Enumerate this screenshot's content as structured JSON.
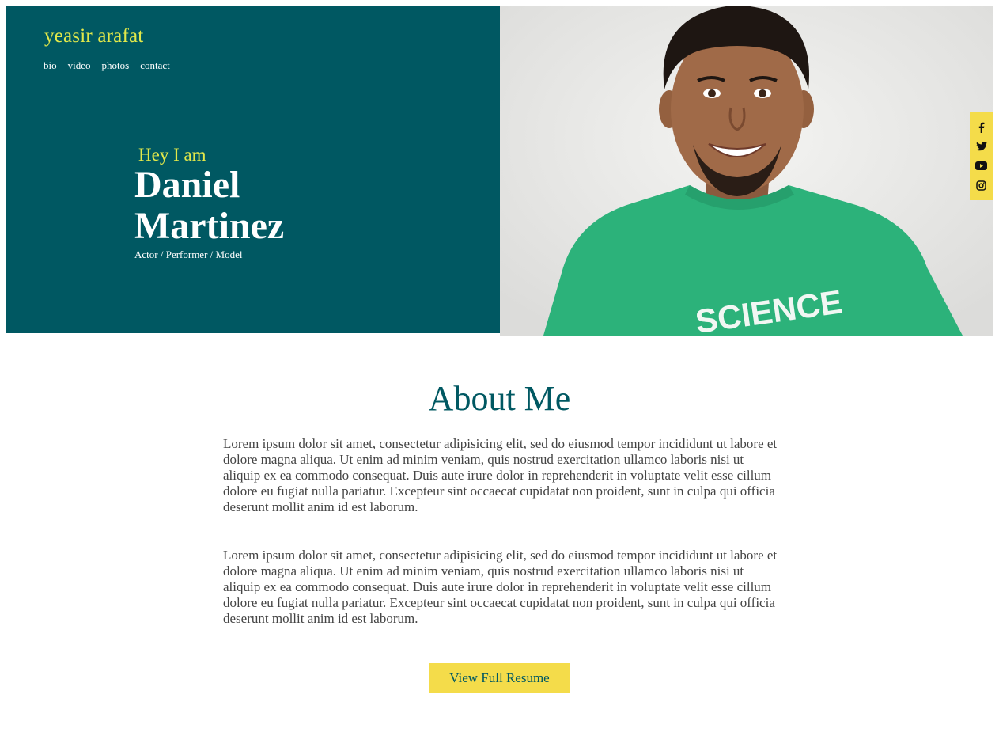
{
  "brand": {
    "name": "yeasir arafat"
  },
  "nav": [
    "bio",
    "video",
    "photos",
    "contact"
  ],
  "hero": {
    "greeting": "Hey I am",
    "first_name": "Daniel",
    "last_name": "Martinez",
    "tagline": "Actor / Performer / Model",
    "shirt_text": "SCIENCE"
  },
  "social": [
    "facebook-icon",
    "twitter-icon",
    "youtube-icon",
    "instagram-icon"
  ],
  "about": {
    "title": "About Me",
    "paragraphs": [
      "Lorem ipsum dolor sit amet, consectetur adipisicing elit, sed do eiusmod tempor incididunt ut labore et dolore magna aliqua. Ut enim ad minim veniam, quis nostrud exercitation ullamco laboris nisi ut aliquip ex ea commodo consequat. Duis aute irure dolor in reprehenderit in voluptate velit esse cillum dolore eu fugiat nulla pariatur. Excepteur sint occaecat cupidatat non proident, sunt in culpa qui officia deserunt mollit anim id est laborum.",
      "Lorem ipsum dolor sit amet, consectetur adipisicing elit, sed do eiusmod tempor incididunt ut labore et dolore magna aliqua. Ut enim ad minim veniam, quis nostrud exercitation ullamco laboris nisi ut aliquip ex ea commodo consequat. Duis aute irure dolor in reprehenderit in voluptate velit esse cillum dolore eu fugiat nulla pariatur. Excepteur sint occaecat cupidatat non proident, sunt in culpa qui officia deserunt mollit anim id est laborum."
    ],
    "button": "View Full Resume"
  },
  "colors": {
    "hero_bg": "#005862",
    "accent_yellow": "#e2e84a",
    "button_yellow": "#f4dc4a",
    "shirt_green": "#2cb27a"
  }
}
